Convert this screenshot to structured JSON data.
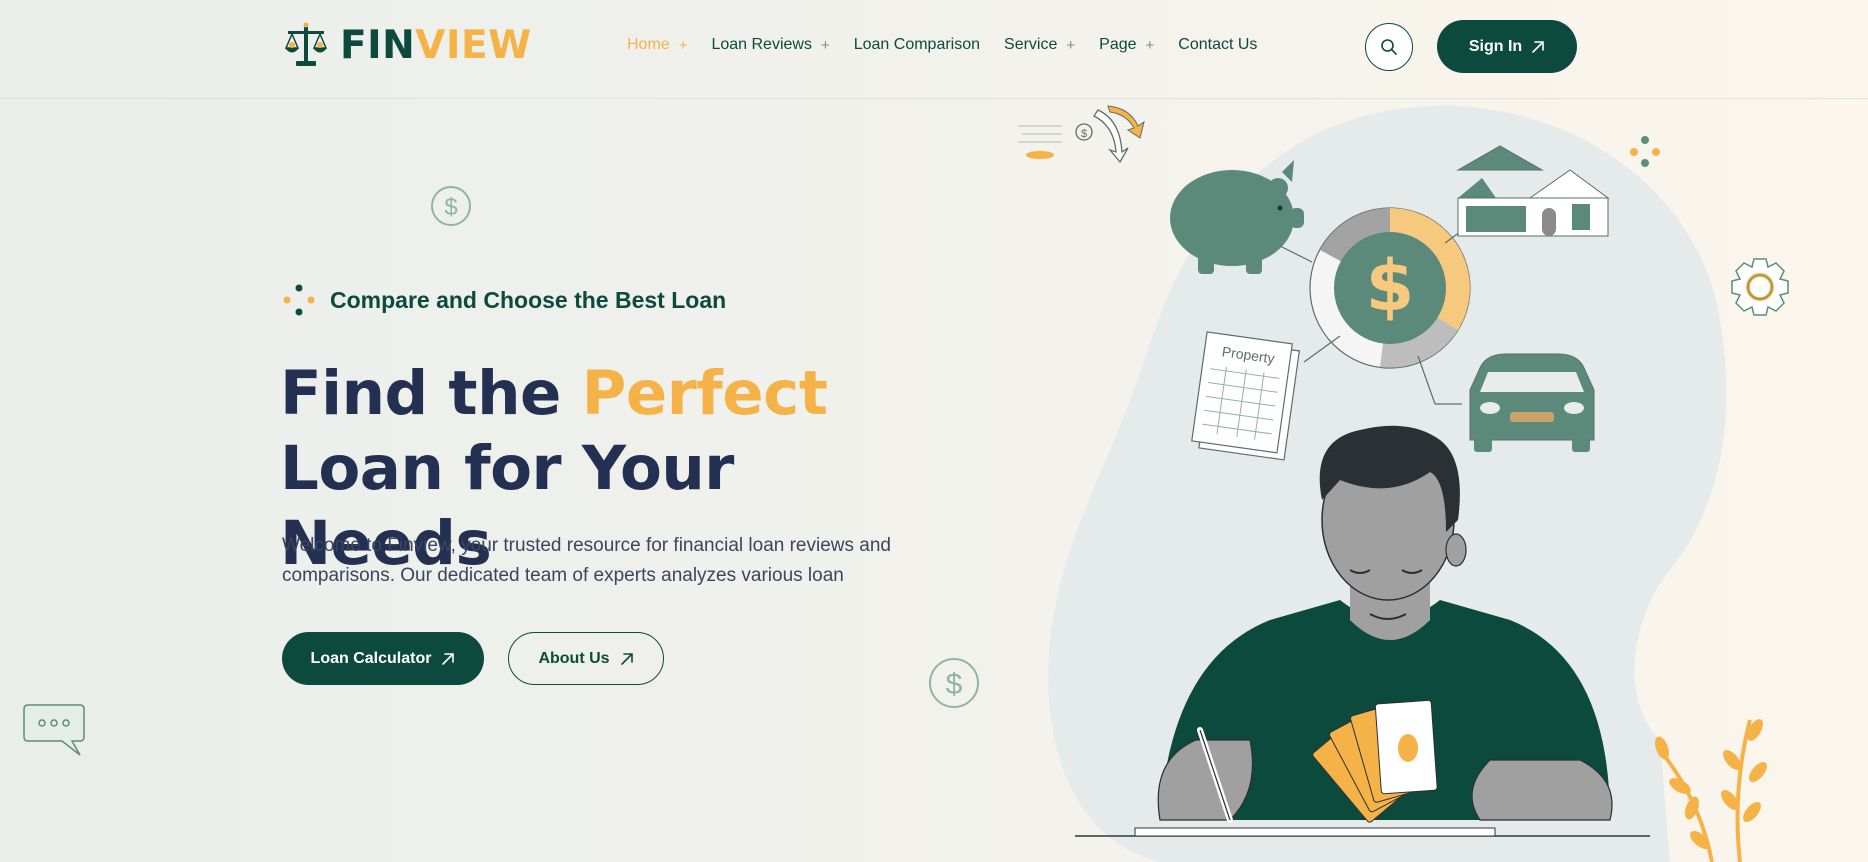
{
  "brand": {
    "name_part1": "FIN",
    "name_part2": "VIEW",
    "primary_color": "#0d4a3e",
    "accent_color": "#f5b347",
    "text_color": "#233052"
  },
  "nav": {
    "items": [
      {
        "label": "Home",
        "has_submenu": true,
        "active": true
      },
      {
        "label": "Loan Reviews",
        "has_submenu": true,
        "active": false
      },
      {
        "label": "Loan Comparison",
        "has_submenu": false,
        "active": false
      },
      {
        "label": "Service",
        "has_submenu": true,
        "active": false
      },
      {
        "label": "Page",
        "has_submenu": true,
        "active": false
      },
      {
        "label": "Contact Us",
        "has_submenu": false,
        "active": false
      }
    ],
    "submenu_marker": "+"
  },
  "header": {
    "search_icon": "search-icon",
    "signin_label": "Sign In"
  },
  "hero": {
    "tagline": "Compare and Choose the Best Loan",
    "headline_part1": "Find the ",
    "headline_accent": "Perfect",
    "headline_part2": " Loan for Your Needs",
    "description": "Welcome to Finview, your trusted resource for financial loan reviews and comparisons. Our dedicated team of experts analyzes various loan",
    "primary_button": "Loan Calculator",
    "secondary_button": "About Us"
  },
  "illustration": {
    "document_label": "Property",
    "currency_symbol": "$"
  },
  "icons": [
    "logo-scale-icon",
    "search-icon",
    "arrow-up-right-icon",
    "dollar-coin-icon",
    "chat-bubble-icon",
    "gear-icon",
    "piggy-bank-icon",
    "house-icon",
    "car-icon"
  ]
}
